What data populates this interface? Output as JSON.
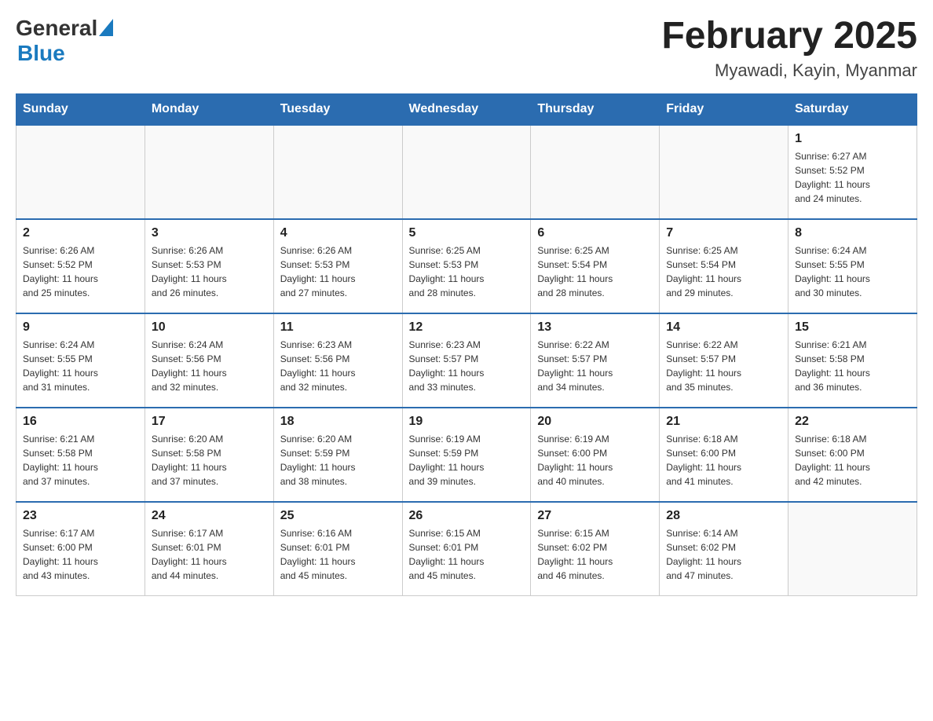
{
  "header": {
    "logo_general": "General",
    "logo_blue": "Blue",
    "month_title": "February 2025",
    "location": "Myawadi, Kayin, Myanmar"
  },
  "weekdays": [
    "Sunday",
    "Monday",
    "Tuesday",
    "Wednesday",
    "Thursday",
    "Friday",
    "Saturday"
  ],
  "weeks": [
    [
      {
        "day": "",
        "info": ""
      },
      {
        "day": "",
        "info": ""
      },
      {
        "day": "",
        "info": ""
      },
      {
        "day": "",
        "info": ""
      },
      {
        "day": "",
        "info": ""
      },
      {
        "day": "",
        "info": ""
      },
      {
        "day": "1",
        "info": "Sunrise: 6:27 AM\nSunset: 5:52 PM\nDaylight: 11 hours\nand 24 minutes."
      }
    ],
    [
      {
        "day": "2",
        "info": "Sunrise: 6:26 AM\nSunset: 5:52 PM\nDaylight: 11 hours\nand 25 minutes."
      },
      {
        "day": "3",
        "info": "Sunrise: 6:26 AM\nSunset: 5:53 PM\nDaylight: 11 hours\nand 26 minutes."
      },
      {
        "day": "4",
        "info": "Sunrise: 6:26 AM\nSunset: 5:53 PM\nDaylight: 11 hours\nand 27 minutes."
      },
      {
        "day": "5",
        "info": "Sunrise: 6:25 AM\nSunset: 5:53 PM\nDaylight: 11 hours\nand 28 minutes."
      },
      {
        "day": "6",
        "info": "Sunrise: 6:25 AM\nSunset: 5:54 PM\nDaylight: 11 hours\nand 28 minutes."
      },
      {
        "day": "7",
        "info": "Sunrise: 6:25 AM\nSunset: 5:54 PM\nDaylight: 11 hours\nand 29 minutes."
      },
      {
        "day": "8",
        "info": "Sunrise: 6:24 AM\nSunset: 5:55 PM\nDaylight: 11 hours\nand 30 minutes."
      }
    ],
    [
      {
        "day": "9",
        "info": "Sunrise: 6:24 AM\nSunset: 5:55 PM\nDaylight: 11 hours\nand 31 minutes."
      },
      {
        "day": "10",
        "info": "Sunrise: 6:24 AM\nSunset: 5:56 PM\nDaylight: 11 hours\nand 32 minutes."
      },
      {
        "day": "11",
        "info": "Sunrise: 6:23 AM\nSunset: 5:56 PM\nDaylight: 11 hours\nand 32 minutes."
      },
      {
        "day": "12",
        "info": "Sunrise: 6:23 AM\nSunset: 5:57 PM\nDaylight: 11 hours\nand 33 minutes."
      },
      {
        "day": "13",
        "info": "Sunrise: 6:22 AM\nSunset: 5:57 PM\nDaylight: 11 hours\nand 34 minutes."
      },
      {
        "day": "14",
        "info": "Sunrise: 6:22 AM\nSunset: 5:57 PM\nDaylight: 11 hours\nand 35 minutes."
      },
      {
        "day": "15",
        "info": "Sunrise: 6:21 AM\nSunset: 5:58 PM\nDaylight: 11 hours\nand 36 minutes."
      }
    ],
    [
      {
        "day": "16",
        "info": "Sunrise: 6:21 AM\nSunset: 5:58 PM\nDaylight: 11 hours\nand 37 minutes."
      },
      {
        "day": "17",
        "info": "Sunrise: 6:20 AM\nSunset: 5:58 PM\nDaylight: 11 hours\nand 37 minutes."
      },
      {
        "day": "18",
        "info": "Sunrise: 6:20 AM\nSunset: 5:59 PM\nDaylight: 11 hours\nand 38 minutes."
      },
      {
        "day": "19",
        "info": "Sunrise: 6:19 AM\nSunset: 5:59 PM\nDaylight: 11 hours\nand 39 minutes."
      },
      {
        "day": "20",
        "info": "Sunrise: 6:19 AM\nSunset: 6:00 PM\nDaylight: 11 hours\nand 40 minutes."
      },
      {
        "day": "21",
        "info": "Sunrise: 6:18 AM\nSunset: 6:00 PM\nDaylight: 11 hours\nand 41 minutes."
      },
      {
        "day": "22",
        "info": "Sunrise: 6:18 AM\nSunset: 6:00 PM\nDaylight: 11 hours\nand 42 minutes."
      }
    ],
    [
      {
        "day": "23",
        "info": "Sunrise: 6:17 AM\nSunset: 6:00 PM\nDaylight: 11 hours\nand 43 minutes."
      },
      {
        "day": "24",
        "info": "Sunrise: 6:17 AM\nSunset: 6:01 PM\nDaylight: 11 hours\nand 44 minutes."
      },
      {
        "day": "25",
        "info": "Sunrise: 6:16 AM\nSunset: 6:01 PM\nDaylight: 11 hours\nand 45 minutes."
      },
      {
        "day": "26",
        "info": "Sunrise: 6:15 AM\nSunset: 6:01 PM\nDaylight: 11 hours\nand 45 minutes."
      },
      {
        "day": "27",
        "info": "Sunrise: 6:15 AM\nSunset: 6:02 PM\nDaylight: 11 hours\nand 46 minutes."
      },
      {
        "day": "28",
        "info": "Sunrise: 6:14 AM\nSunset: 6:02 PM\nDaylight: 11 hours\nand 47 minutes."
      },
      {
        "day": "",
        "info": ""
      }
    ]
  ]
}
